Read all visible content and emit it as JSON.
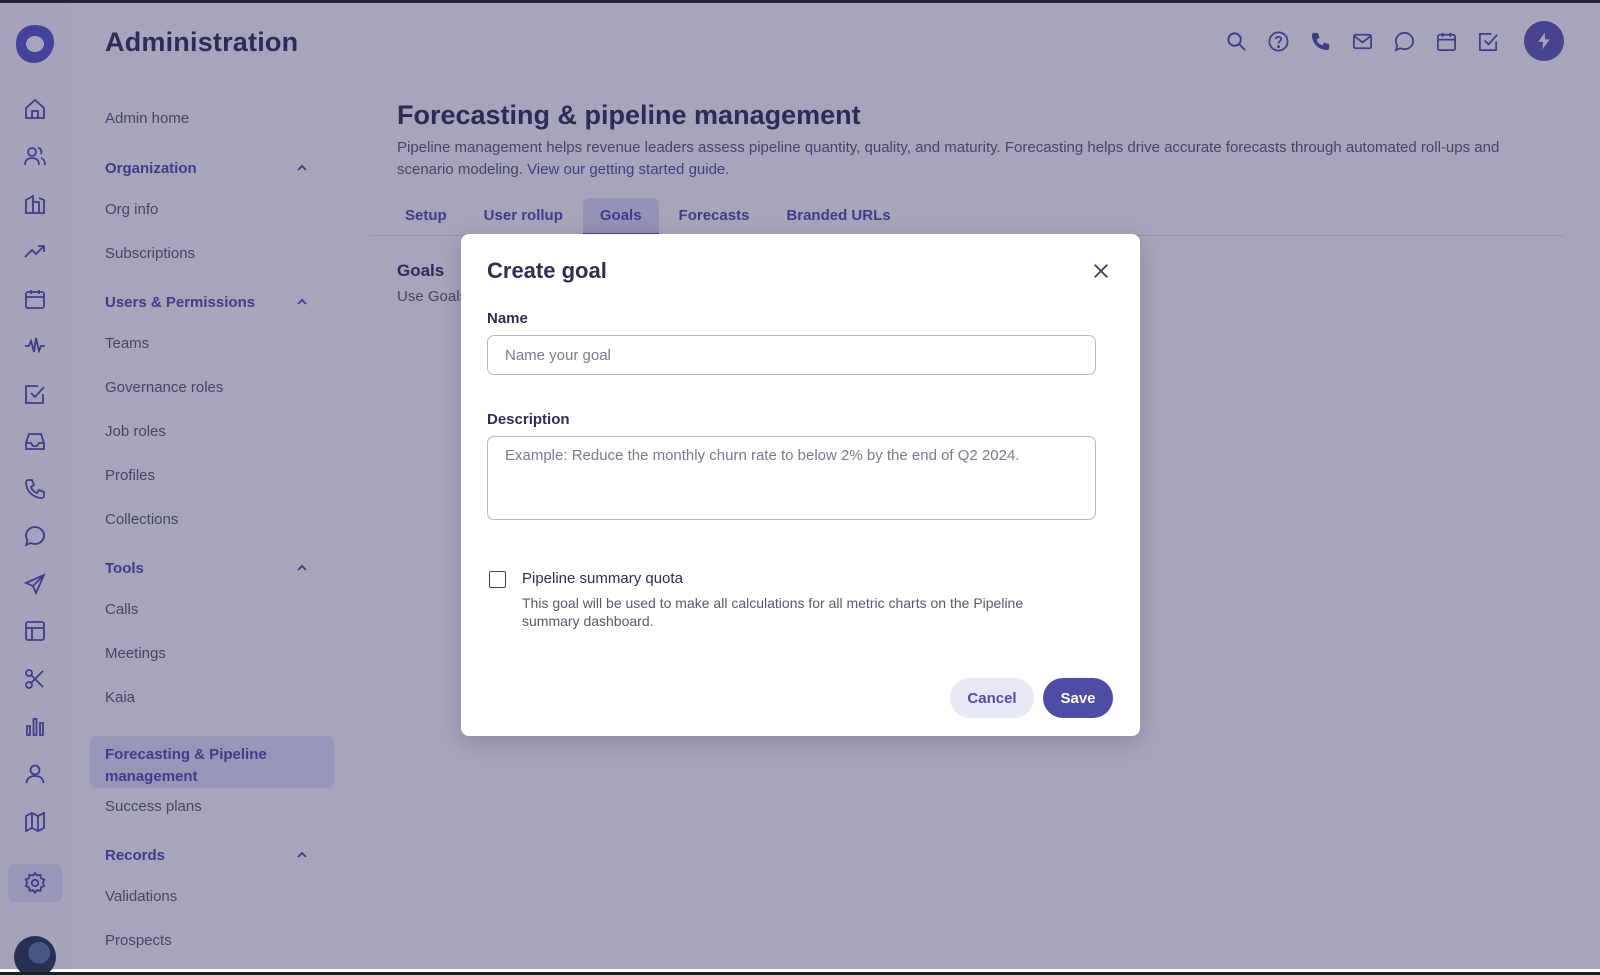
{
  "header": {
    "title": "Administration"
  },
  "header_icons": [
    "search-icon",
    "help-icon",
    "phone-icon",
    "mail-icon",
    "chat-icon",
    "calendar-icon",
    "task-check-icon",
    "bolt-icon"
  ],
  "rail_icons": [
    "home-icon",
    "people-icon",
    "accounts-icon",
    "trending-icon",
    "calendar-icon",
    "activity-icon",
    "task-check-icon",
    "inbox-icon",
    "phone-icon",
    "chat-icon",
    "send-icon",
    "layout-icon",
    "scissors-icon",
    "bar-chart-icon",
    "person-icon",
    "map-icon",
    "settings-icon"
  ],
  "sidebar": {
    "admin_home": "Admin home",
    "organization": {
      "label": "Organization",
      "items": [
        "Org info",
        "Subscriptions"
      ]
    },
    "users_permissions": {
      "label": "Users & Permissions",
      "items": [
        "Teams",
        "Governance roles",
        "Job roles",
        "Profiles",
        "Collections"
      ]
    },
    "tools": {
      "label": "Tools",
      "items": [
        "Calls",
        "Meetings",
        "Kaia",
        "Forecasting & Pipeline management",
        "Success plans"
      ],
      "active": "Forecasting & Pipeline management"
    },
    "records": {
      "label": "Records",
      "items": [
        "Validations",
        "Prospects"
      ]
    }
  },
  "main": {
    "title": "Forecasting & pipeline management",
    "description": "Pipeline management helps revenue leaders assess pipeline quantity, quality, and maturity. Forecasting helps drive accurate forecasts through automated roll-ups and scenario modeling.",
    "guide_link": "View our getting started guide",
    "tabs": [
      "Setup",
      "User rollup",
      "Goals",
      "Forecasts",
      "Branded URLs"
    ],
    "active_tab": "Goals",
    "goals_heading": "Goals",
    "goals_sub": "Use Goals"
  },
  "modal": {
    "title": "Create goal",
    "name_label": "Name",
    "name_placeholder": "Name your goal",
    "name_value": "",
    "description_label": "Description",
    "description_placeholder": "Example: Reduce the monthly churn rate to below 2% by the end of Q2 2024.",
    "description_value": "",
    "checkbox_label": "Pipeline summary quota",
    "checkbox_checked": false,
    "checkbox_help": "This goal will be used to make all calculations for all metric charts on the Pipeline summary dashboard.",
    "cancel_label": "Cancel",
    "save_label": "Save"
  },
  "colors": {
    "accent": "#4f4ca6",
    "overlay": "#2e2860",
    "text": "#2e2e52"
  }
}
